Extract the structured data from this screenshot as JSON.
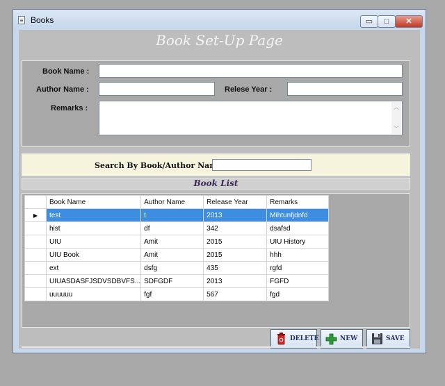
{
  "window": {
    "title": "Books"
  },
  "window_controls": {
    "minimize": "▭",
    "maximize": "□",
    "close": "✕"
  },
  "header": {
    "title": "Book Set-Up Page"
  },
  "form": {
    "book_name_label": "Book Name :",
    "author_name_label": "Author Name :",
    "release_year_label": "Relese Year :",
    "remarks_label": "Remarks  :",
    "book_name_value": "",
    "author_name_value": "",
    "release_year_value": "",
    "remarks_value": ""
  },
  "search": {
    "label": "Search By Book/Author Name :",
    "value": ""
  },
  "list": {
    "title": "Book List",
    "columns": [
      "Book Name",
      "Author Name",
      "Release Year",
      "Remarks"
    ],
    "row_indicator": "▶",
    "rows": [
      [
        "test",
        "t",
        "2013",
        "Mihtunfjdnfd"
      ],
      [
        "hist",
        "df",
        "342",
        "dsafsd"
      ],
      [
        "UIU",
        "Amit",
        "2015",
        "UIU History"
      ],
      [
        "UIU Book",
        "Amit",
        "2015",
        "hhh"
      ],
      [
        "ext",
        "dsfg",
        "435",
        "rgfd"
      ],
      [
        "UIUASDASFJSDVSDBVFS...",
        "SDFGDF",
        "2013",
        "FGFD"
      ],
      [
        "uuuuuu",
        "fgf",
        "567",
        "fgd"
      ]
    ]
  },
  "buttons": {
    "delete": "DELETE",
    "new": "NEW",
    "save": "SAVE"
  },
  "colors": {
    "selection": "#3d8ee0",
    "search_panel": "#f6f4dc",
    "client_bg": "#bdbdbd"
  }
}
